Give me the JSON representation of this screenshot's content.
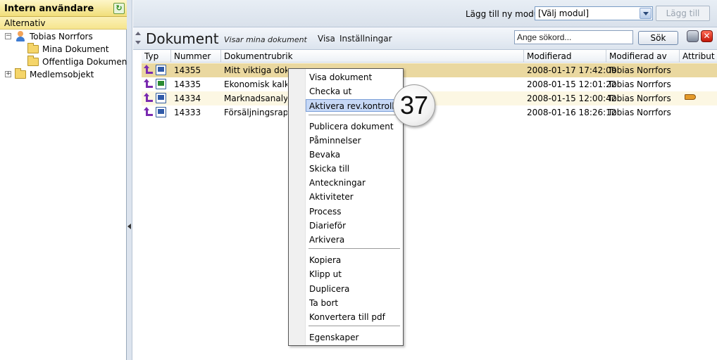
{
  "left": {
    "title": "Intern användare",
    "alternativ": "Alternativ",
    "tree": {
      "user": "Tobias Norrfors",
      "my_docs": "Mina Dokument",
      "public_docs": "Offentliga Dokument",
      "members": "Medlemsobjekt"
    }
  },
  "toolbar": {
    "module_label": "Lägg till ny modul",
    "module_selected": "[Välj modul]",
    "add_label": "Lägg till"
  },
  "docs": {
    "title": "Dokument",
    "subtitle": "Visar mina dokument",
    "link_visa": "Visa",
    "link_settings": "Inställningar",
    "search_value": "Ange sökord...",
    "search_button": "Sök",
    "close_symbol": "✕",
    "columns": [
      "Typ",
      "Nummer",
      "Dokumentrubrik",
      "Modifierad",
      "Modifierad av",
      "Attribut"
    ],
    "rows": [
      {
        "number": "14355",
        "title": "Mitt viktiga dokument",
        "modified": "2008-01-17 17:42:09",
        "modified_by": "Tobias Norrfors",
        "file_type": "doc-icon",
        "attr": ""
      },
      {
        "number": "14335",
        "title": "Ekonomisk kalkyl",
        "modified": "2008-01-15 12:01:22",
        "modified_by": "Tobias Norrfors",
        "file_type": "xls-icon",
        "attr": ""
      },
      {
        "number": "14334",
        "title": "Marknadsanalys",
        "modified": "2008-01-15 12:00:42",
        "modified_by": "Tobias Norrfors",
        "file_type": "doc-icon",
        "attr": "key-icon"
      },
      {
        "number": "14333",
        "title": "Försäljningsrapport",
        "modified": "2008-01-16 18:26:12",
        "modified_by": "Tobias Norrfors",
        "file_type": "doc-icon",
        "attr": ""
      }
    ]
  },
  "context_menu": {
    "items": [
      "Visa dokument",
      "Checka ut",
      "Aktivera rev.kontroll",
      "Publicera dokument",
      "Påminnelser",
      "Bevaka",
      "Skicka till",
      "Anteckningar",
      "Aktiviteter",
      "Process",
      "Diarieför",
      "Arkivera",
      "Kopiera",
      "Klipp ut",
      "Duplicera",
      "Ta bort",
      "Konvertera till pdf",
      "Egenskaper"
    ],
    "highlighted": "Aktivera rev.kontroll"
  },
  "callout": "37",
  "colors": {
    "selected_row": "#ead8a0",
    "header_yellow": "#f1df7a",
    "menu_highlight": "#c6d8f6"
  }
}
